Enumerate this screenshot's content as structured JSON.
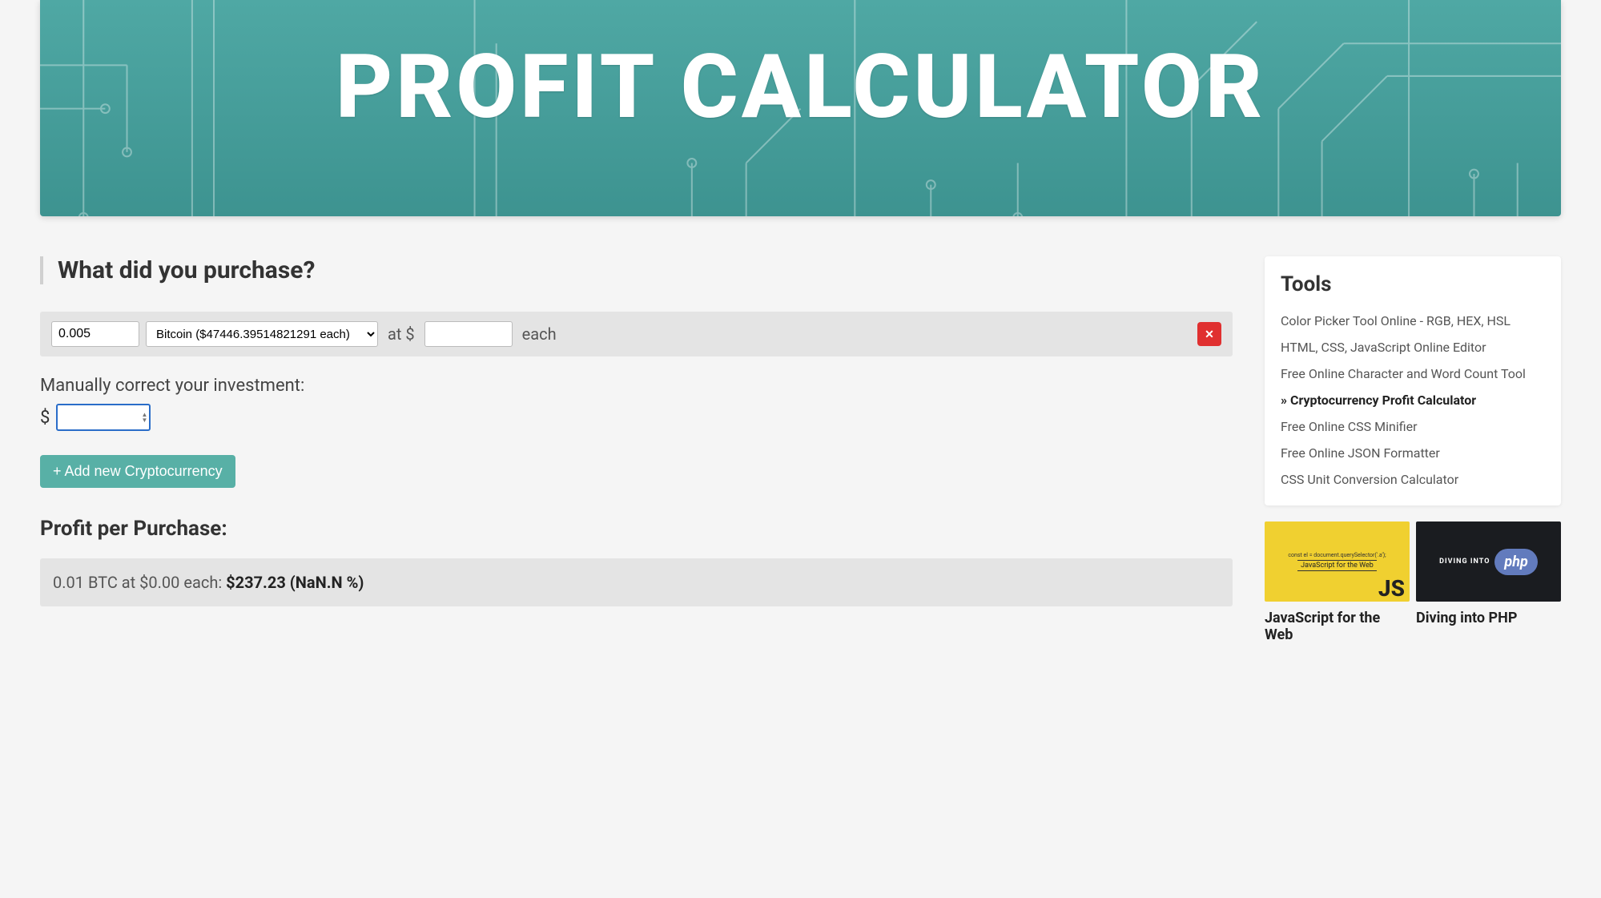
{
  "hero": {
    "title": "PROFIT CALCULATOR"
  },
  "main": {
    "purchase_heading": "What did you purchase?",
    "row": {
      "qty": "0.005",
      "crypto": "Bitcoin ($47446.39514821291 each)",
      "at_label": "at $",
      "price": "",
      "each_label": "each",
      "delete_icon": "✕"
    },
    "manual_label": "Manually correct your investment:",
    "dollar_sign": "$",
    "investment_value": "",
    "add_label": "+ Add new Cryptocurrency",
    "profit_heading": "Profit per Purchase:",
    "profit_line_prefix": "0.01 BTC at $0.00 each:  ",
    "profit_line_value": "$237.23 (NaN.N %)"
  },
  "sidebar": {
    "tools_title": "Tools",
    "items": [
      {
        "label": "Color Picker Tool Online - RGB, HEX, HSL",
        "active": false
      },
      {
        "label": "HTML, CSS, JavaScript Online Editor",
        "active": false
      },
      {
        "label": "Free Online Character and Word Count Tool",
        "active": false
      },
      {
        "label": "» Cryptocurrency Profit Calculator",
        "active": true
      },
      {
        "label": "Free Online CSS Minifier",
        "active": false
      },
      {
        "label": "Free Online JSON Formatter",
        "active": false
      },
      {
        "label": "CSS Unit Conversion Calculator",
        "active": false
      }
    ],
    "courses": [
      {
        "title": "JavaScript for the Web",
        "thumb_sub": "JavaScript for the Web",
        "thumb_big": "JS"
      },
      {
        "title": "Diving into PHP",
        "thumb_label": "DIVING INTO",
        "thumb_pill": "php"
      }
    ]
  }
}
